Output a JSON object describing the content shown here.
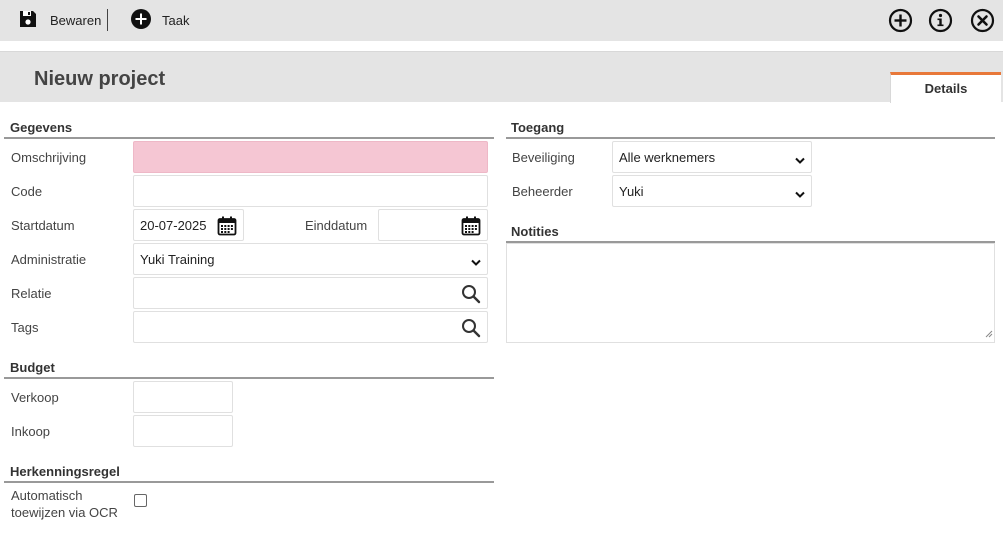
{
  "toolbar": {
    "save_label": "Bewaren",
    "task_label": "Taak",
    "save_icon": "floppy-disk-icon",
    "task_icon": "plus-circle-icon",
    "right_icons": [
      "add-circle-icon",
      "info-circle-icon",
      "close-circle-icon"
    ]
  },
  "page": {
    "title": "Nieuw project",
    "tab_details": "Details",
    "accent_color": "#e8783a",
    "required_bg": "#f5c6d3"
  },
  "gegevens": {
    "header": "Gegevens",
    "omschrijving_label": "Omschrijving",
    "omschrijving_value": "",
    "code_label": "Code",
    "code_value": "",
    "startdatum_label": "Startdatum",
    "startdatum_value": "20-07-2025",
    "einddatum_label": "Einddatum",
    "einddatum_value": "",
    "administratie_label": "Administratie",
    "administratie_value": "Yuki Training",
    "relatie_label": "Relatie",
    "relatie_value": "",
    "tags_label": "Tags",
    "tags_value": ""
  },
  "budget": {
    "header": "Budget",
    "verkoop_label": "Verkoop",
    "verkoop_value": "",
    "inkoop_label": "Inkoop",
    "inkoop_value": ""
  },
  "herkenningsregel": {
    "header": "Herkenningsregel",
    "ocr_label_line1": "Automatisch",
    "ocr_label_line2": "toewijzen via OCR",
    "ocr_checked": false
  },
  "toegang": {
    "header": "Toegang",
    "beveiliging_label": "Beveiliging",
    "beveiliging_value": "Alle werknemers",
    "beheerder_label": "Beheerder",
    "beheerder_value": "Yuki"
  },
  "notities": {
    "header": "Notities",
    "value": ""
  }
}
